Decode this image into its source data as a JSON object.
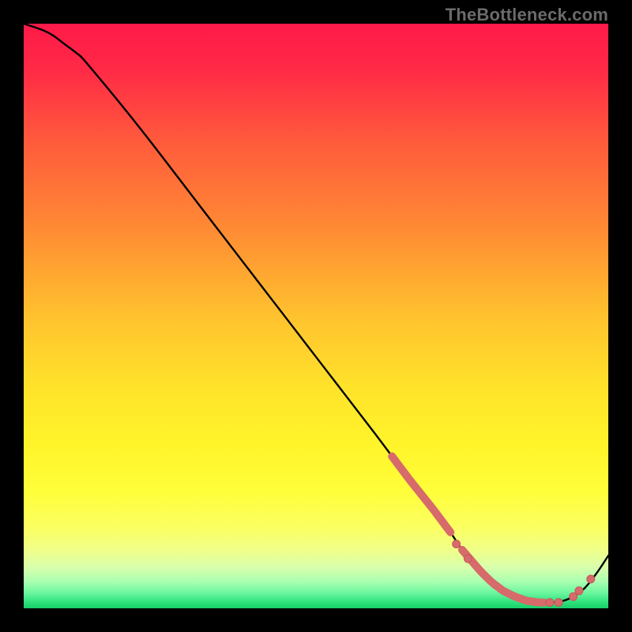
{
  "watermark": "TheBottleneck.com",
  "colors": {
    "gradient_stops": [
      {
        "stop": 0.0,
        "color": "#ff1a49"
      },
      {
        "stop": 0.08,
        "color": "#ff2a46"
      },
      {
        "stop": 0.2,
        "color": "#ff5a3c"
      },
      {
        "stop": 0.35,
        "color": "#ff8a34"
      },
      {
        "stop": 0.5,
        "color": "#ffc22e"
      },
      {
        "stop": 0.62,
        "color": "#ffe22a"
      },
      {
        "stop": 0.72,
        "color": "#fff42a"
      },
      {
        "stop": 0.8,
        "color": "#fffe3a"
      },
      {
        "stop": 0.86,
        "color": "#fbff60"
      },
      {
        "stop": 0.9,
        "color": "#f0ff88"
      },
      {
        "stop": 0.93,
        "color": "#d8ffad"
      },
      {
        "stop": 0.955,
        "color": "#a8ffb0"
      },
      {
        "stop": 0.975,
        "color": "#66f59c"
      },
      {
        "stop": 0.99,
        "color": "#2de07a"
      },
      {
        "stop": 1.0,
        "color": "#18cf6a"
      }
    ],
    "curve": "#000000",
    "dot_fill": "#d76a6a",
    "dot_stroke": "#c45a5a"
  },
  "chart_data": {
    "type": "line",
    "title": "",
    "xlabel": "",
    "ylabel": "",
    "xlim": [
      0,
      100
    ],
    "ylim": [
      0,
      100
    ],
    "series": [
      {
        "name": "bottleneck-curve",
        "x": [
          0,
          3,
          5,
          7,
          9,
          11,
          20,
          30,
          40,
          50,
          60,
          66,
          70,
          73,
          75,
          78,
          80,
          82,
          84,
          86,
          88,
          90,
          92,
          94,
          96,
          98,
          100
        ],
        "y": [
          100,
          99,
          98,
          96.5,
          95,
          93,
          82,
          69,
          56,
          43,
          30,
          22,
          17,
          13,
          10,
          6.5,
          4.5,
          3,
          2,
          1.3,
          1,
          1,
          1.2,
          2,
          3.5,
          6,
          9
        ]
      }
    ],
    "overweight_segments": [
      {
        "x_start": 63,
        "x_end": 73
      },
      {
        "x_start": 75,
        "x_end": 89
      }
    ],
    "points": [
      {
        "x": 74,
        "y": 11
      },
      {
        "x": 76,
        "y": 8.5
      },
      {
        "x": 90,
        "y": 1
      },
      {
        "x": 91.5,
        "y": 1
      },
      {
        "x": 94,
        "y": 2
      },
      {
        "x": 95,
        "y": 3
      },
      {
        "x": 97,
        "y": 5
      }
    ]
  }
}
